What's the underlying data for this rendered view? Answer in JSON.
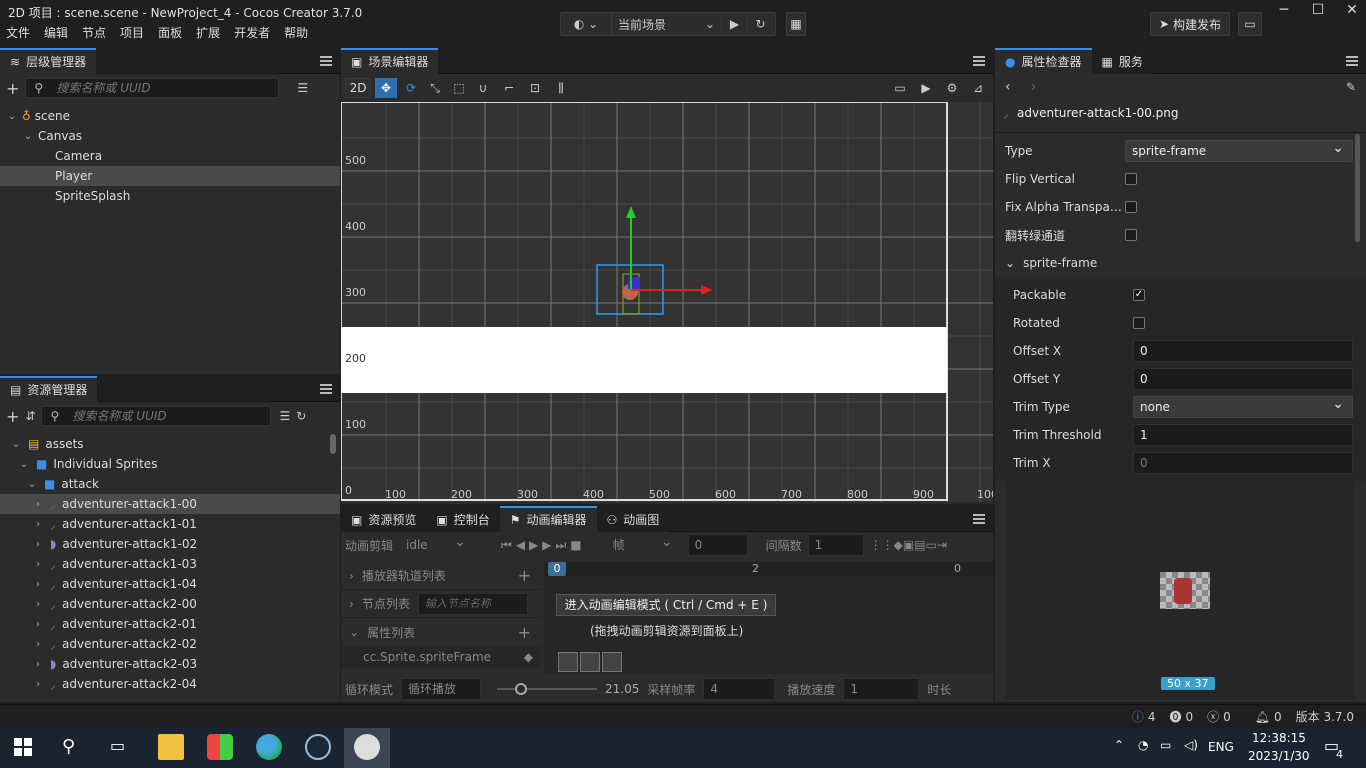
{
  "window": {
    "title": "2D 项目 : scene.scene - NewProject_4 - Cocos Creator 3.7.0"
  },
  "menu": [
    "文件",
    "编辑",
    "节点",
    "项目",
    "面板",
    "扩展",
    "开发者",
    "帮助"
  ],
  "toolbar": {
    "scene_select": "当前场景",
    "build_button": "构建发布"
  },
  "hierarchy": {
    "title": "层级管理器",
    "search_placeholder": "搜索名称或 UUID",
    "nodes": [
      {
        "label": "scene",
        "depth": 0,
        "expanded": true
      },
      {
        "label": "Canvas",
        "depth": 1,
        "expanded": true
      },
      {
        "label": "Camera",
        "depth": 2
      },
      {
        "label": "Player",
        "depth": 2,
        "selected": true
      },
      {
        "label": "SpriteSplash",
        "depth": 2
      }
    ]
  },
  "assets": {
    "title": "资源管理器",
    "search_placeholder": "搜索名称或 UUID",
    "items": [
      {
        "label": "assets",
        "depth": 0
      },
      {
        "label": "Individual Sprites",
        "depth": 1
      },
      {
        "label": "attack",
        "depth": 2
      },
      {
        "label": "adventurer-attack1-00",
        "depth": 3,
        "selected": true
      },
      {
        "label": "adventurer-attack1-01",
        "depth": 3
      },
      {
        "label": "adventurer-attack1-02",
        "depth": 3
      },
      {
        "label": "adventurer-attack1-03",
        "depth": 3
      },
      {
        "label": "adventurer-attack1-04",
        "depth": 3
      },
      {
        "label": "adventurer-attack2-00",
        "depth": 3
      },
      {
        "label": "adventurer-attack2-01",
        "depth": 3
      },
      {
        "label": "adventurer-attack2-02",
        "depth": 3
      },
      {
        "label": "adventurer-attack2-03",
        "depth": 3
      },
      {
        "label": "adventurer-attack2-04",
        "depth": 3
      }
    ]
  },
  "scene_editor": {
    "title": "场景编辑器",
    "mode_2d": "2D",
    "y_labels": [
      "500",
      "400",
      "300",
      "200",
      "100",
      "0"
    ],
    "x_labels": [
      "100",
      "200",
      "300",
      "400",
      "500",
      "600",
      "700",
      "800",
      "900",
      "100"
    ]
  },
  "bottom_panel": {
    "tabs": [
      "资源预览",
      "控制台",
      "动画编辑器",
      "动画图"
    ],
    "active_tab": "动画编辑器",
    "clip_label": "动画剪辑",
    "clip_value": "idle",
    "frame_unit": "帧",
    "frame_value": "0",
    "interval_label": "间隔数",
    "interval_value": "1",
    "track_list": "播放器轨道列表",
    "node_list": "节点列表",
    "node_search_placeholder": "输入节点名称",
    "property_list": "属性列表",
    "property_item": "cc.Sprite.spriteFrame",
    "timeline_marks": [
      "0",
      "2",
      "0"
    ],
    "enter_button": "进入动画编辑模式 ( Ctrl / Cmd + E )",
    "hint": "(拖拽动画剪辑资源到面板上)",
    "loop_label": "循环模式",
    "loop_value": "循环播放",
    "duration": "21.05",
    "sample_label": "采样帧率",
    "sample_value": "4",
    "speed_label": "播放速度",
    "speed_value": "1",
    "time_label": "时长"
  },
  "inspector": {
    "tab_label": "属性检查器",
    "service_tab": "服务",
    "file_name": "adventurer-attack1-00.png",
    "type_label": "Type",
    "type_value": "sprite-frame",
    "flip_vertical": "Flip Vertical",
    "fix_alpha": "Fix Alpha Transpar...",
    "flip_green": "翻转绿通道",
    "section": "sprite-frame",
    "packable": "Packable",
    "packable_checked": true,
    "rotated": "Rotated",
    "offset_x_label": "Offset X",
    "offset_x": "0",
    "offset_y_label": "Offset Y",
    "offset_y": "0",
    "trim_type_label": "Trim Type",
    "trim_type": "none",
    "trim_threshold_label": "Trim Threshold",
    "trim_threshold": "1",
    "trim_x_label": "Trim X",
    "trim_x": "0",
    "preview_size": "50 x 37"
  },
  "status": {
    "info": "4",
    "warn": "0",
    "error": "0",
    "notify": "0",
    "version": "版本 3.7.0"
  },
  "taskbar": {
    "time": "12:38:15",
    "date": "2023/1/30",
    "lang": "ENG",
    "notif": "4"
  },
  "colors": {
    "accent": "#3b8eea",
    "bg": "#2b2b2b",
    "taskbar": "#1a2430"
  }
}
